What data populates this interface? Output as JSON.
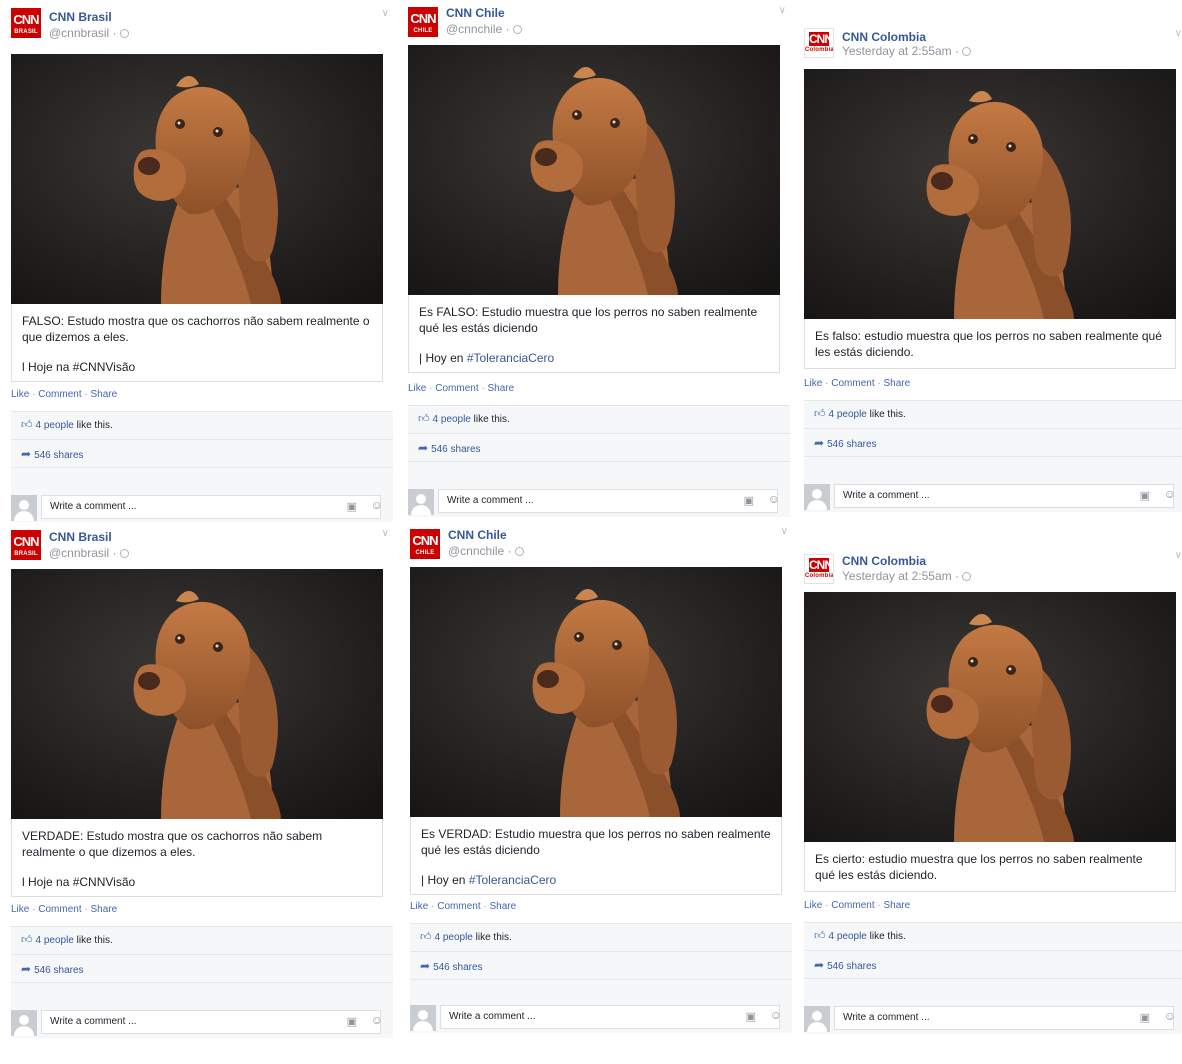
{
  "common": {
    "likes_link": "4 people",
    "likes_rest": " like this.",
    "shares": "546 shares",
    "comment_placeholder": "Write a comment ...",
    "action_like": "Like",
    "action_comment": "Comment",
    "action_share": "Share",
    "sep": " · "
  },
  "posts": [
    {
      "page": "CNN Brasil",
      "meta": "@cnnbrasil ·",
      "logo": "CNN",
      "logo_sub": "BRASIL",
      "caption": "FALSO: Estudo mostra que os cachorros não sabem realmente o que dizemos a eles.",
      "line2_prefix": "l Hoje na ",
      "line2_tag": "#CNNVisão",
      "tag_link": false
    },
    {
      "page": "CNN Chile",
      "meta": "@cnnchile ·",
      "logo": "CNN",
      "logo_sub": "CHILE",
      "caption": "Es FALSO: Estudio muestra que los perros no saben realmente qué les estás diciendo",
      "line2_prefix": "| Hoy en ",
      "line2_tag": "#ToleranciaCero",
      "tag_link": true
    },
    {
      "page": "CNN Colombia",
      "meta": "Yesterday at 2:55am ·",
      "logo": "CNN",
      "logo_sub": "Colombia",
      "caption": "Es falso: estudio muestra que los perros no saben realmente qué les estás diciendo.",
      "line2_prefix": "",
      "line2_tag": "",
      "tag_link": false
    },
    {
      "page": "CNN Brasil",
      "meta": "@cnnbrasil ·",
      "logo": "CNN",
      "logo_sub": "BRASIL",
      "caption": "VERDADE: Estudo mostra que os cachorros não sabem realmente o que dizemos a eles.",
      "line2_prefix": "l Hoje na ",
      "line2_tag": "#CNNVisão",
      "tag_link": false
    },
    {
      "page": "CNN Chile",
      "meta": "@cnnchile ·",
      "logo": "CNN",
      "logo_sub": "CHILE",
      "caption": "Es VERDAD: Estudio muestra que los perros no saben realmente qué les estás diciendo",
      "line2_prefix": "| Hoy en ",
      "line2_tag": "#ToleranciaCero",
      "tag_link": true
    },
    {
      "page": "CNN Colombia",
      "meta": "Yesterday at 2:55am ·",
      "logo": "CNN",
      "logo_sub": "Colombia",
      "caption": "Es cierto: estudio muestra que los perros no saben realmente qué les estás diciendo.",
      "line2_prefix": "",
      "line2_tag": "",
      "tag_link": false
    }
  ],
  "colors": {
    "link": "#365899",
    "cnn_red": "#cc0000",
    "bar_bg": "#f6f7f9"
  },
  "icons": [
    "chevron-down-icon",
    "globe-icon",
    "thumbs-up-icon",
    "share-arrow-icon",
    "camera-icon",
    "smiley-icon",
    "avatar-icon"
  ]
}
